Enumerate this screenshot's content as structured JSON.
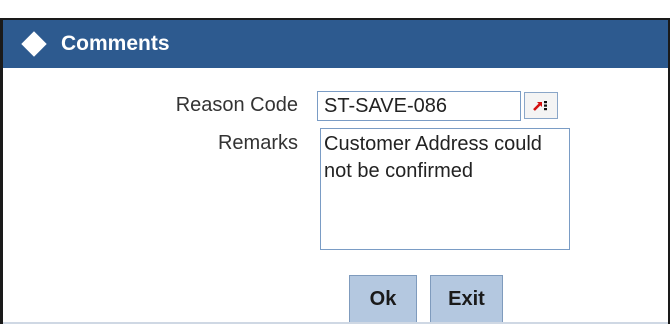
{
  "window": {
    "title": "Comments",
    "title_icon": "diamond-icon",
    "titlebar_color": "#2d5a8f"
  },
  "form": {
    "reason_code_label": "Reason Code",
    "reason_code_value": "ST-SAVE-086",
    "lov_icon": "list-of-values-icon",
    "remarks_label": "Remarks",
    "remarks_value": "Customer Address could not be confirmed"
  },
  "buttons": {
    "ok_label": "Ok",
    "exit_label": "Exit",
    "button_color": "#b4c8e0"
  }
}
